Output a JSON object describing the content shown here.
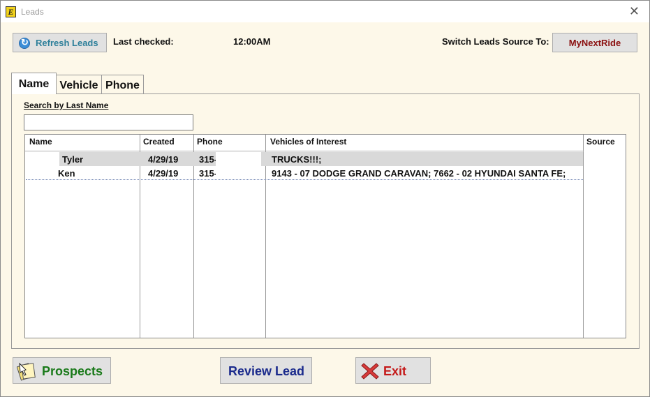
{
  "window": {
    "title": "Leads",
    "app_icon": "E"
  },
  "toolbar": {
    "refresh_label": "Refresh Leads",
    "last_checked_label": "Last checked:",
    "last_checked_value": "12:00AM",
    "switch_label": "Switch Leads Source To:",
    "switch_source_button": "MyNextRide"
  },
  "tabs": [
    {
      "label": "Name",
      "active": true
    },
    {
      "label": "Vehicle",
      "active": false
    },
    {
      "label": "Phone",
      "active": false
    }
  ],
  "search": {
    "label": "Search by Last Name",
    "value": "",
    "placeholder": ""
  },
  "table": {
    "columns": [
      "Name",
      "Created",
      "Phone",
      "Vehicles of Interest",
      "Source"
    ],
    "rows": [
      {
        "name": "Tyler",
        "created": "4/29/19",
        "phone": "315-",
        "vehicles": "TRUCKS!!!;",
        "source": "",
        "selected": true
      },
      {
        "name": "Ken",
        "created": "4/29/19",
        "phone": "315-",
        "vehicles": "9143 - 07 DODGE GRAND CARAVAN; 7662 - 02 HYUNDAI SANTA FE;",
        "source": "",
        "selected": false
      }
    ]
  },
  "actions": {
    "prospects_label": "Prospects",
    "review_label": "Review Lead",
    "exit_label": "Exit"
  },
  "colors": {
    "window_bg": "#fdf8e9",
    "refresh_text": "#2d7f9a",
    "source_text": "#8b1010",
    "prospects_text": "#1a7a1a",
    "review_text": "#1a2a8c",
    "exit_text": "#c41818"
  }
}
